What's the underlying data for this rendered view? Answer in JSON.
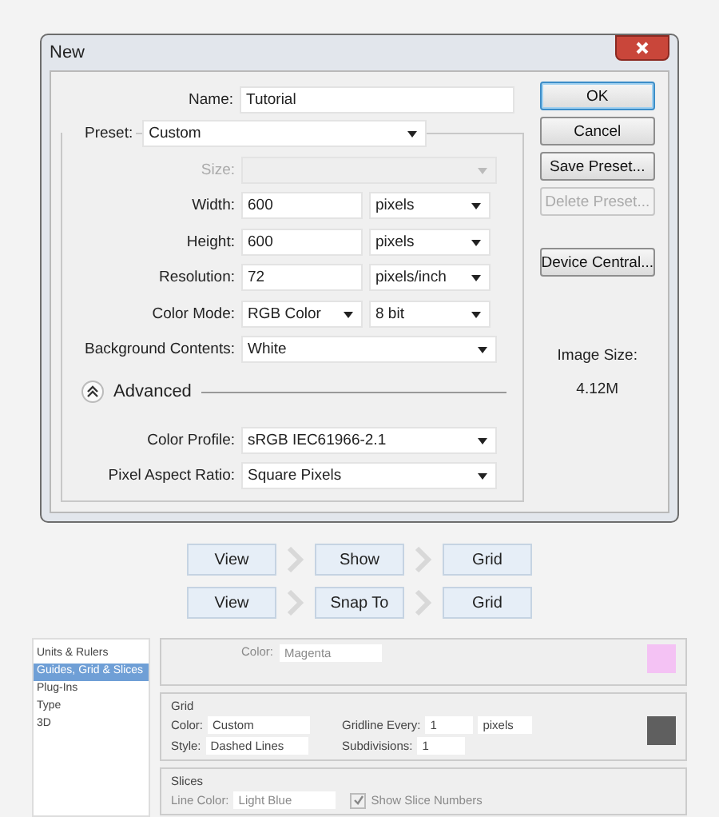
{
  "dialog": {
    "title": "New",
    "name": {
      "label": "Name:",
      "value": "Tutorial"
    },
    "preset": {
      "label": "Preset:",
      "value": "Custom"
    },
    "fields": [
      {
        "kind": "select",
        "label": "Size:",
        "disabled": true
      },
      {
        "kind": "input_select",
        "label": "Width:",
        "value": "600",
        "unit": "pixels",
        "disabled": false
      },
      {
        "kind": "input_select",
        "label": "Height:",
        "value": "600",
        "unit": "pixels",
        "disabled": false
      },
      {
        "kind": "input_select",
        "label": "Resolution:",
        "value": "72",
        "unit": "pixels/inch",
        "disabled": false
      },
      {
        "kind": "select_select",
        "label": "Color Mode:",
        "value": "RGB Color",
        "unit": "8 bit",
        "disabled": false
      },
      {
        "kind": "select",
        "label": "Background Contents:",
        "value": "White",
        "disabled": false
      }
    ],
    "advanced": {
      "label": "Advanced",
      "expanded": true,
      "fields": [
        {
          "kind": "select",
          "label": "Color Profile:",
          "value": "sRGB IEC61966-2.1",
          "disabled": false
        },
        {
          "kind": "select",
          "label": "Pixel Aspect Ratio:",
          "value": "Square Pixels",
          "disabled": false
        }
      ]
    },
    "buttons": [
      {
        "label": "OK",
        "default": true,
        "disabled": false
      },
      {
        "label": "Cancel",
        "default": false,
        "disabled": false
      },
      {
        "label": "Save Preset...",
        "default": false,
        "disabled": false
      },
      {
        "label": "Delete Preset...",
        "default": false,
        "disabled": true
      },
      {
        "label": "Device Central...",
        "default": false,
        "disabled": false
      }
    ],
    "image_size": {
      "label": "Image Size:",
      "value": "4.12M"
    }
  },
  "breadcrumbs": [
    [
      "View",
      "Show",
      "Grid"
    ],
    [
      "View",
      "Snap To",
      "Grid"
    ]
  ],
  "preferences": {
    "sidebar": [
      {
        "label": "Units & Rulers",
        "selected": false
      },
      {
        "label": "Guides, Grid & Slices",
        "selected": true
      },
      {
        "label": "Plug-Ins",
        "selected": false
      },
      {
        "label": "Type",
        "selected": false
      },
      {
        "label": "3D",
        "selected": false
      }
    ],
    "guides": {
      "color_label": "Color:",
      "color_value": "Magenta"
    },
    "grid": {
      "title": "Grid",
      "color_label": "Color:",
      "color_value": "Custom",
      "style_label": "Style:",
      "style_value": "Dashed Lines",
      "every_label": "Gridline Every:",
      "every_value": "1",
      "every_unit": "pixels",
      "sub_label": "Subdivisions:",
      "sub_value": "1"
    },
    "slices": {
      "title": "Slices",
      "color_label": "Line Color:",
      "color_value": "Light Blue",
      "numbers_label": "Show Slice Numbers",
      "numbers_checked": true
    }
  }
}
